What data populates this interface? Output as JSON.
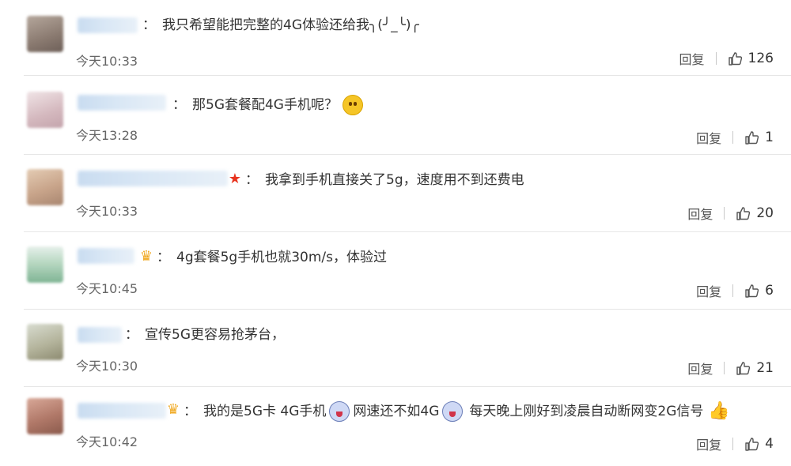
{
  "comments": [
    {
      "text": "我只希望能把完整的4G体验还给我╮(╯_╰)╭",
      "time": "今天10:33",
      "reply": "回复",
      "likes": "126",
      "avatar_color": "#9a8a80",
      "name_blur_width": 0,
      "badge": ""
    },
    {
      "text": "那5G套餐配4G手机呢？",
      "time": "今天13:28",
      "reply": "回复",
      "likes": "1",
      "avatar_color": "#d8c0c4",
      "emoji_after": "smile",
      "badge": ""
    },
    {
      "text": "我拿到手机直接关了5g，速度用不到还费电",
      "time": "今天10:33",
      "reply": "回复",
      "likes": "20",
      "avatar_color": "#c8a48a",
      "badge": "star"
    },
    {
      "text": "4g套餐5g手机也就30m/s，体验过",
      "time": "今天10:45",
      "reply": "回复",
      "likes": "6",
      "avatar_color": "#9cc4a8",
      "badge": "crown"
    },
    {
      "text": "宣传5G更容易抢茅台，",
      "time": "今天10:30",
      "reply": "回复",
      "likes": "21",
      "avatar_color": "#a8a890",
      "badge": ""
    },
    {
      "text_parts": [
        "我的是5G卡 4G手机",
        "网速还不如4G",
        "每天晚上刚好到凌晨自动断网变2G信号"
      ],
      "time": "今天10:42",
      "reply": "回复",
      "likes": "4",
      "avatar_color": "#b07868",
      "badge": "crown"
    }
  ],
  "colon": "：",
  "colors": {
    "divider": "#e6e6e6",
    "name_blur": "#c9dcf0",
    "star_badge": "#e8341f",
    "crown_badge": "#f0a81f"
  }
}
